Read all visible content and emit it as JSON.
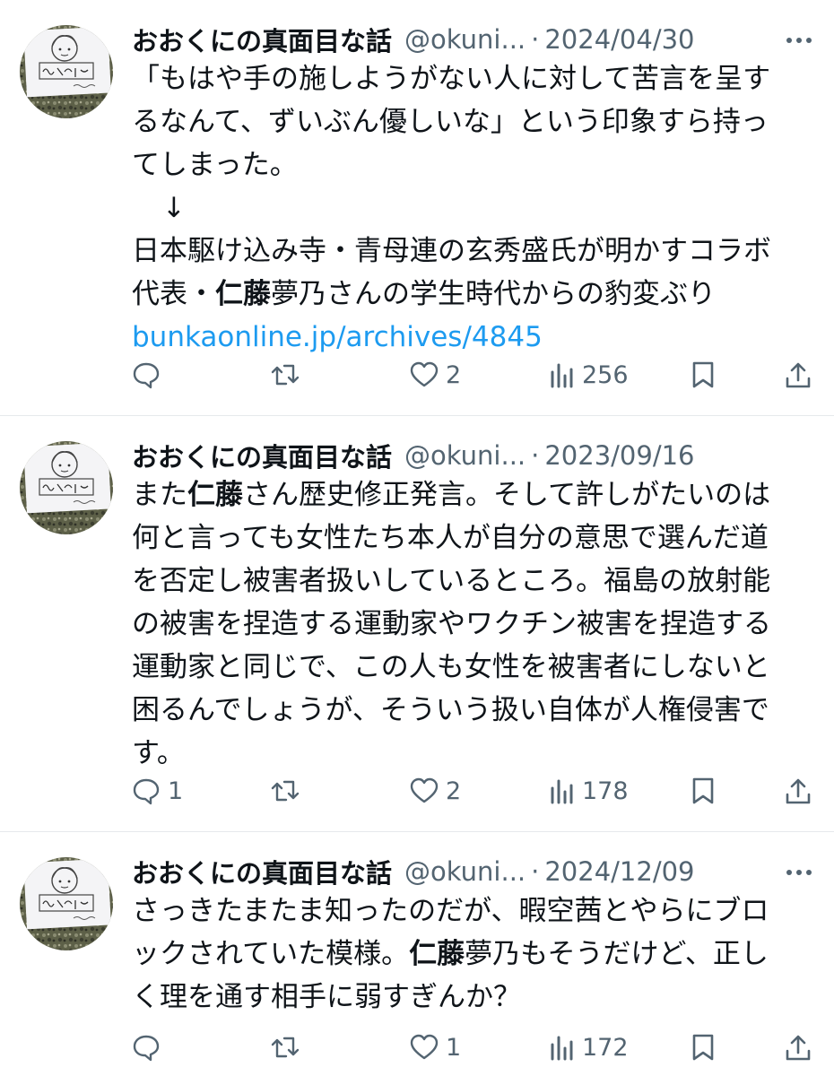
{
  "colors": {
    "text": "#0f1419",
    "muted": "#536471",
    "link": "#1d9bf0",
    "divider": "#e6e9ec"
  },
  "avatar": {
    "sign_text": "おおくに先生",
    "small_text": "Oomoon E"
  },
  "icons": [
    "reply-icon",
    "retweet-icon",
    "like-icon",
    "views-icon",
    "bookmark-icon",
    "share-icon",
    "more-icon"
  ],
  "tweets": [
    {
      "author": "おおくにの真面目な話",
      "handle": "@okuni...",
      "sep": "·",
      "date": "2024/04/30",
      "lines": {
        "l1": "「もはや手の施しようがない人に対して苦言を呈す",
        "l2": "るなんて、ずいぶん優しいな」という印象すら持っ",
        "l3": "てしまった。",
        "arrow": "↓",
        "l5": "日本駆け込み寺・青母連の玄秀盛氏が明かすコラボ",
        "l6_pre": "代表・",
        "l6_bold": "仁藤",
        "l6_post": "夢乃さんの学生時代からの豹変ぶり",
        "link": "bunkaonline.jp/archives/4845"
      },
      "stats": {
        "replies": "",
        "retweets": "",
        "likes": "2",
        "views": "256"
      }
    },
    {
      "author": "おおくにの真面目な話",
      "handle": "@okuni...",
      "sep": "·",
      "date": "2023/09/16",
      "lines": {
        "l1_pre": "また",
        "l1_bold": "仁藤",
        "l1_post": "さん歴史修正発言。そして許しがたいのは",
        "l2": "何と言っても女性たち本人が自分の意思で選んだ道",
        "l3": "を否定し被害者扱いしているところ。福島の放射能",
        "l4": "の被害を捏造する運動家やワクチン被害を捏造する",
        "l5": "運動家と同じで、この人も女性を被害者にしないと",
        "l6": "困るんでしょうが、そういう扱い自体が人権侵害で",
        "l7": "す。"
      },
      "stats": {
        "replies": "1",
        "retweets": "",
        "likes": "2",
        "views": "178"
      }
    },
    {
      "author": "おおくにの真面目な話",
      "handle": "@okuni...",
      "sep": "·",
      "date": "2024/12/09",
      "lines": {
        "l1": "さっきたまたま知ったのだが、暇空茜とやらにブロ",
        "l2_pre": "ックされていた模様。",
        "l2_bold": "仁藤",
        "l2_post": "夢乃もそうだけど、正し",
        "l3": "く理を通す相手に弱すぎんか？"
      },
      "stats": {
        "replies": "",
        "retweets": "",
        "likes": "1",
        "views": "172"
      }
    }
  ]
}
